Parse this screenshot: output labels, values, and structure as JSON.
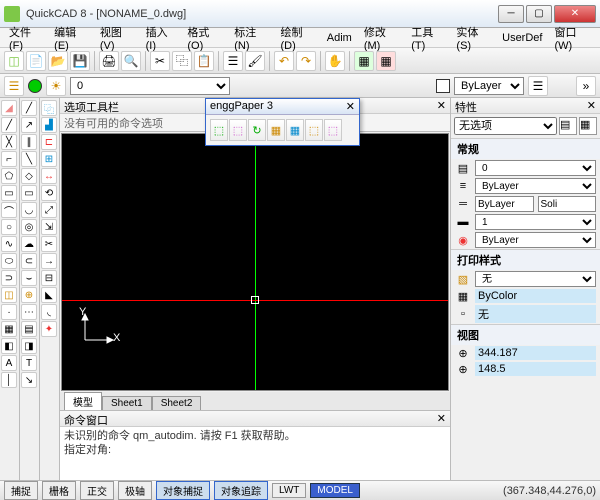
{
  "title": "QuickCAD 8 - [NONAME_0.dwg]",
  "menu": [
    "文件(F)",
    "编辑(E)",
    "视图(V)",
    "插入(I)",
    "格式(O)",
    "标注(N)",
    "绘制(D)",
    "Adim",
    "修改(M)",
    "工具(T)",
    "实体(S)",
    "UserDef",
    "窗口(W)"
  ],
  "layer_bar": {
    "layer_value": "0",
    "bylayer": "ByLayer"
  },
  "options_panel": {
    "title": "选项工具栏",
    "body": "没有可用的命令选项"
  },
  "floating_palette": {
    "title": "enggPaper 3"
  },
  "tabs": [
    "模型",
    "Sheet1",
    "Sheet2"
  ],
  "command_panel": {
    "title": "命令窗口",
    "lines": [
      "未识别的命令 qm_autodim. 请按 F1 获取帮助。",
      "指定对角:"
    ]
  },
  "properties": {
    "title": "特性",
    "selection": "无选项",
    "sections": {
      "general": {
        "head": "常规",
        "layer": "0",
        "linetype": "ByLayer",
        "linetype_scale_label": "ByLayer",
        "linetype_scale_val": "Soli",
        "lineweight": "1",
        "color": "ByLayer"
      },
      "plot": {
        "head": "打印样式",
        "style": "无",
        "bycolor": "ByColor",
        "none": "无"
      },
      "view": {
        "head": "视图",
        "x": "344.187",
        "y": "148.5"
      }
    }
  },
  "statusbar": {
    "buttons": [
      "捕捉",
      "栅格",
      "正交",
      "极轴",
      "对象捕捉",
      "对象追踪",
      "LWT",
      "MODEL"
    ],
    "active": [
      4,
      5
    ],
    "coords": "(367.348,44.276,0)"
  },
  "ucs": {
    "x": "X",
    "y": "Y"
  }
}
